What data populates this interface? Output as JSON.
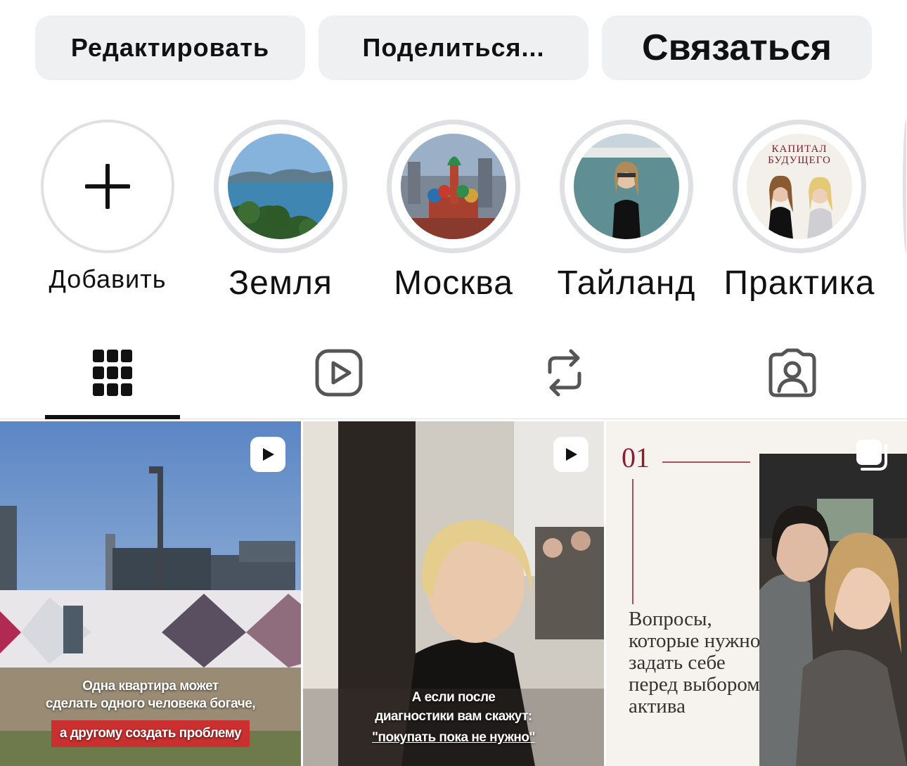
{
  "actions": {
    "edit": "Редактировать",
    "share": "Поделиться...",
    "contact": "Связаться"
  },
  "highlights": [
    {
      "label": "Добавить",
      "icon": "plus-icon"
    },
    {
      "label": "Земля",
      "cover": "sea-landscape"
    },
    {
      "label": "Москва",
      "cover": "moscow-cathedral"
    },
    {
      "label": "Тайланд",
      "cover": "woman-on-beach"
    },
    {
      "label": "Практика",
      "cover": "kapital-budushchego",
      "cover_text": "КАПИТАЛ БУДУЩЕГО"
    }
  ],
  "tabs": [
    {
      "name": "grid",
      "icon": "grid-icon",
      "active": true
    },
    {
      "name": "reels",
      "icon": "reels-icon"
    },
    {
      "name": "reposts",
      "icon": "repost-icon"
    },
    {
      "name": "tagged",
      "icon": "tagged-person-icon"
    }
  ],
  "posts": [
    {
      "type": "reel",
      "caption_line1": "Одна квартира может",
      "caption_line2": "сделать одного человека богаче,",
      "caption_highlight": "а другому создать проблему"
    },
    {
      "type": "reel",
      "caption_line1": "А если после",
      "caption_line2": "диагностики вам скажут:",
      "caption_line3": "\"покупать пока не нужно\""
    },
    {
      "type": "carousel",
      "number": "01",
      "text": "Вопросы, которые нужно задать себе перед выбором актива"
    }
  ],
  "colors": {
    "button_bg": "#eff0f2",
    "ring": "#dfe0e3",
    "caption_red": "#c9302f",
    "serif_accent": "#8b1d2c"
  }
}
